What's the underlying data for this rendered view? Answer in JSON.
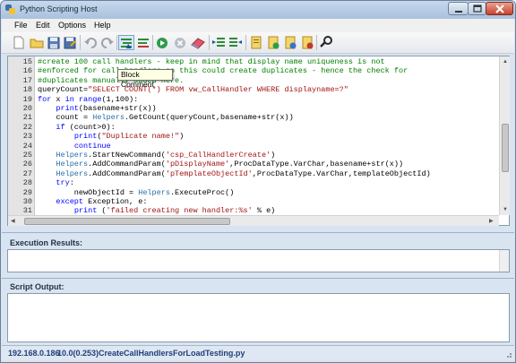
{
  "window": {
    "title": "Python Scripting Host"
  },
  "menu": {
    "file": "File",
    "edit": "Edit",
    "options": "Options",
    "help": "Help"
  },
  "toolbar": {
    "tooltip": "Block Comment",
    "icons": [
      "new-file-icon",
      "open-folder-icon",
      "save-icon",
      "save-as-icon",
      "undo-icon",
      "redo-icon",
      "block-comment-icon",
      "block-uncomment-icon",
      "run-icon",
      "stop-icon",
      "clear-icon",
      "indent-icon",
      "outdent-icon",
      "script-icon",
      "script-add-icon",
      "script-run-icon",
      "script-remove-icon",
      "connect-icon"
    ]
  },
  "editor": {
    "line_numbers": [
      "15",
      "16",
      "17",
      "18",
      "19",
      "20",
      "21",
      "22",
      "23",
      "24",
      "25",
      "26",
      "27",
      "28",
      "29",
      "30",
      "31"
    ],
    "lines": [
      "#create 100 call handlers - keep in mind that display name uniqueness is not",
      "#enforced for call handlers so this could create duplicates - hence the check for",
      "#duplicates manually added here.",
      "queryCount=\"SELECT COUNT(*) FROM vw_CallHandler WHERE displayname=?\"",
      "for x in range(1,100):",
      "    print(basename+str(x))",
      "    count = Helpers.GetCount(queryCount,basename+str(x))",
      "    if (count>0):",
      "        print(\"Duplicate name!\")",
      "        continue",
      "    Helpers.StartNewCommand('csp_CallHandlerCreate')",
      "    Helpers.AddCommandParam('pDisplayName',ProcDataType.VarChar,basename+str(x))",
      "    Helpers.AddCommandParam('pTemplateObjectId',ProcDataType.VarChar,templateObjectId)",
      "    try:",
      "        newObjectId = Helpers.ExecuteProc()",
      "    except Exception, e:",
      "        print ('failed creating new handler:%s' % e)"
    ]
  },
  "panels": {
    "execution_results": "Execution Results:",
    "script_output": "Script Output:"
  },
  "status": {
    "server": "192.168.0.186",
    "version": "10.0(0.253)",
    "script": "CreateCallHandlersForLoadTesting.py"
  }
}
